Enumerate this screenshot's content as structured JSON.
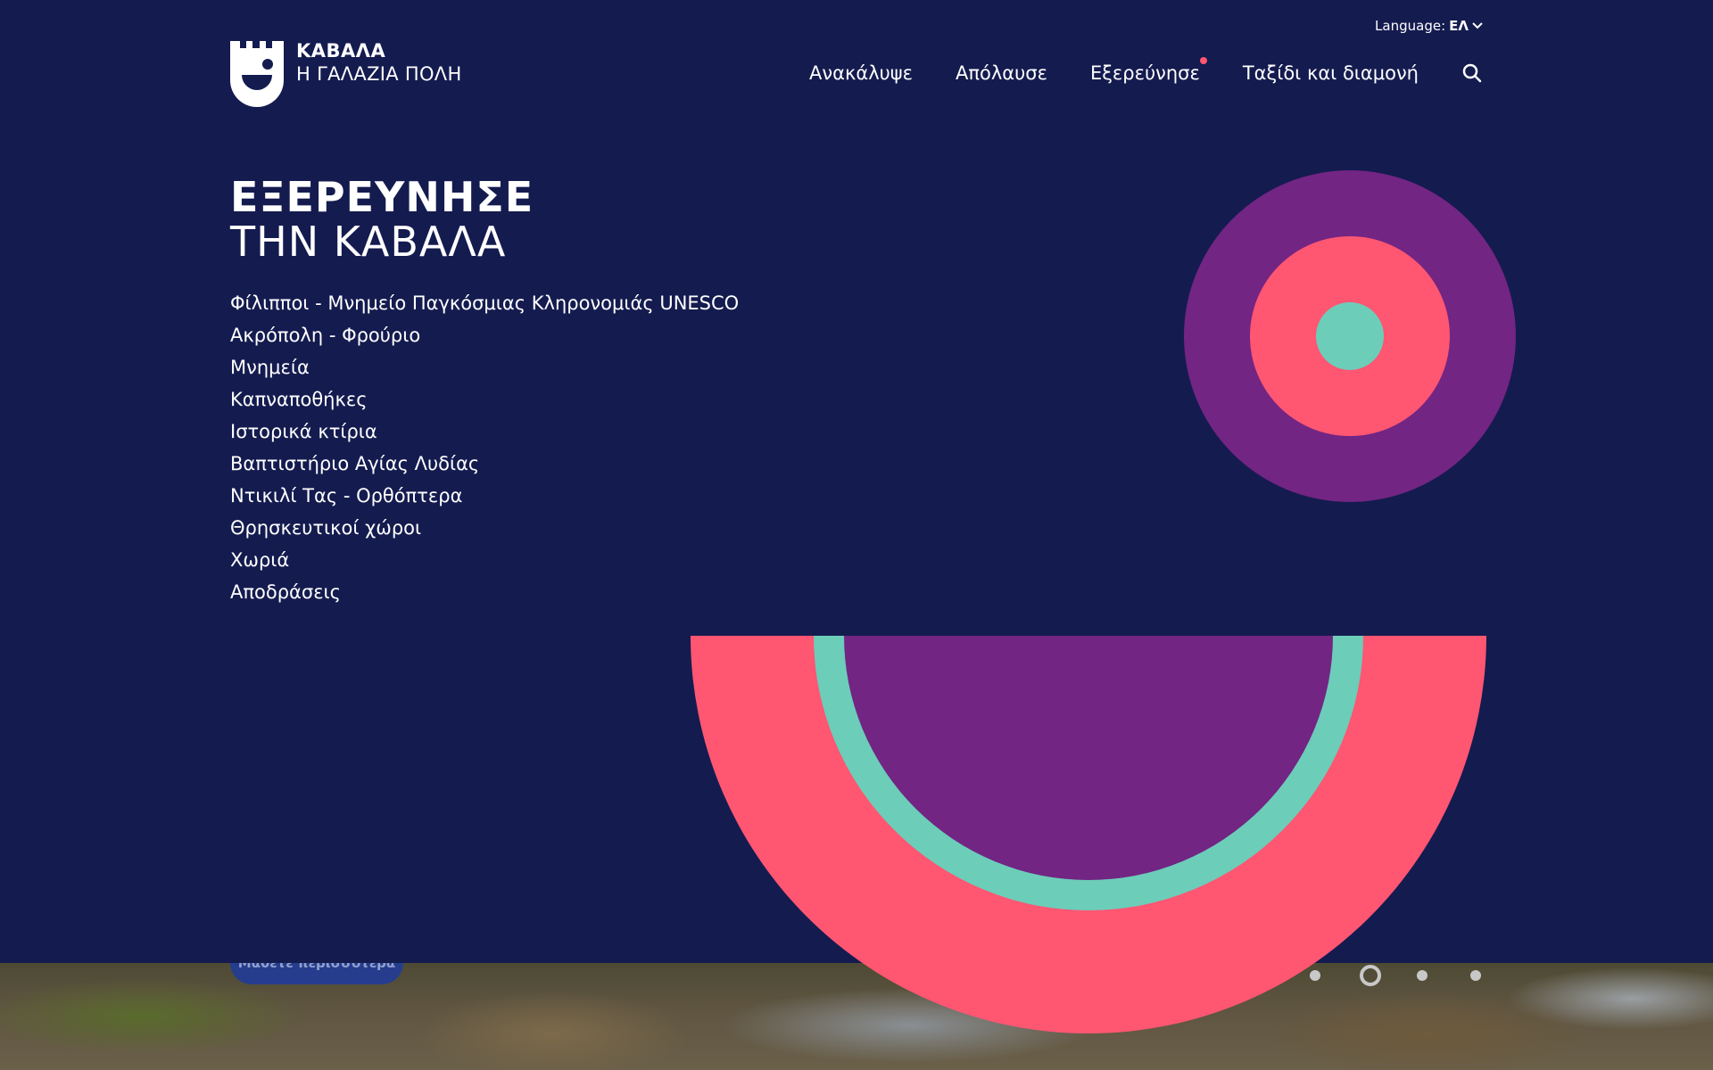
{
  "brand": {
    "title": "ΚΑΒΑΛΑ",
    "subtitle": "Η ΓΑΛΑΖΙΑ ΠΟΛΗ",
    "logo_icon": "castle-smile-logo"
  },
  "language": {
    "label": "Language:",
    "current": "ΕΛ",
    "icon": "chevron-down-icon"
  },
  "nav": {
    "items": [
      {
        "label": "Ανακάλυψε",
        "active": false
      },
      {
        "label": "Απόλαυσε",
        "active": false
      },
      {
        "label": "Εξερεύνησε",
        "active": true
      },
      {
        "label": "Ταξίδι και διαμονή",
        "active": false
      }
    ],
    "search_icon": "search-icon"
  },
  "menu": {
    "heading_strong": "ΕΞΕΡΕΥΝΗΣΕ",
    "heading_light": "ΤΗΝ ΚΑΒΑΛΑ",
    "links": [
      "Φίλιπποι - Μνημείο Παγκόσμιας Κληρονομιάς UNESCO",
      "Ακρόπολη - Φρούριο",
      "Μνημεία",
      "Καπναποθήκες",
      "Ιστορικά κτίρια",
      "Βαπτιστήριο Αγίας Λυδίας",
      "Ντικιλί Τας - Ορθόπτερα",
      "Θρησκευτικοί χώροι",
      "Χωριά",
      "Αποδράσεις"
    ]
  },
  "hero": {
    "cta_label": "Μάθετε περισσότερα",
    "slides_count": 4,
    "active_slide": 2
  },
  "colors": {
    "background": "#141b4f",
    "purple": "#722583",
    "coral": "#ff5672",
    "mint": "#6ccdb9",
    "button": "#1f3b9e"
  }
}
